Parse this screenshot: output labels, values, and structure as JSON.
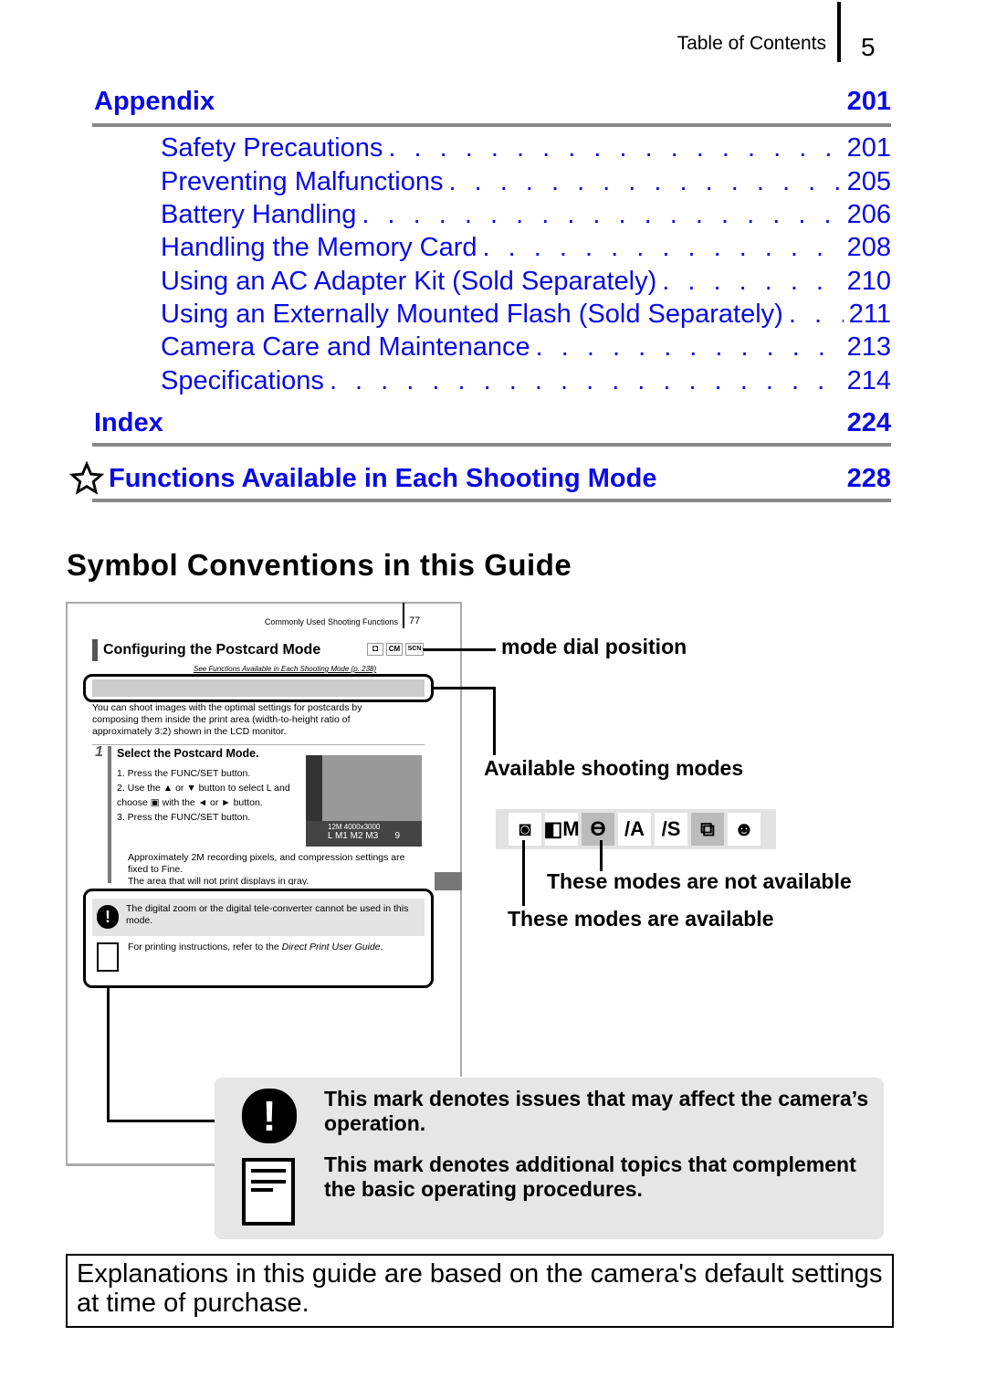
{
  "header": {
    "section": "Table of Contents",
    "page": "5"
  },
  "toc": {
    "appendix": {
      "label": "Appendix",
      "page": "201"
    },
    "entries": [
      {
        "label": "Safety Precautions",
        "page": "201"
      },
      {
        "label": "Preventing Malfunctions",
        "page": "205"
      },
      {
        "label": "Battery Handling",
        "page": "206"
      },
      {
        "label": "Handling the Memory Card",
        "page": "208"
      },
      {
        "label": "Using an AC Adapter Kit (Sold Separately)",
        "page": "210"
      },
      {
        "label": "Using an Externally Mounted Flash (Sold Separately)",
        "page": "211"
      },
      {
        "label": "Camera Care and Maintenance",
        "page": "213"
      },
      {
        "label": "Specifications",
        "page": "214"
      }
    ],
    "index": {
      "label": "Index",
      "page": "224"
    },
    "functions": {
      "label": "Functions Available in Each Shooting Mode",
      "page": "228",
      "icon": "star-icon"
    }
  },
  "symbols": {
    "title": "Symbol Conventions in this Guide",
    "sample": {
      "header": "Commonly Used Shooting Functions",
      "page": "77",
      "title": "Configuring the Postcard Mode",
      "mode_icons": [
        "camera",
        "CM",
        "SCN"
      ],
      "see_ref": "See Functions Available in Each Shooting Mode (p. 238)",
      "intro": "You can shoot images with the optimal settings for postcards by composing them inside the print area (width-to-height ratio of approximately 3:2) shown in the LCD monitor.",
      "step_num": "1",
      "step_title": "Select the Postcard Mode.",
      "steps": [
        "1. Press the FUNC/SET button.",
        "2. Use the ▲ or ▼ button to select L and choose ▣ with the ◄ or ► button.",
        "3. Press the FUNC/SET button."
      ],
      "bullets": [
        "Approximately 2M recording pixels, and compression settings are fixed to Fine.",
        "The area that will not print displays in gray."
      ],
      "lcd": {
        "res": "12M 4000x3000",
        "sizes": "L  M1 M2 M3",
        "count": "9"
      },
      "caution": "The digital zoom or the digital tele-converter cannot be used in this mode.",
      "memo_pre": "For printing instructions, refer to the ",
      "memo_em": "Direct Print User Guide",
      "memo_post": "."
    },
    "labels": {
      "mode_dial": "mode dial position",
      "available_modes": "Available shooting modes",
      "not_available": "These modes are not available",
      "available": "These modes are available"
    },
    "mode_strip": [
      "camera",
      "CM",
      "portrait-D",
      "A",
      "S",
      "stitch",
      "face"
    ],
    "notes": [
      {
        "icon": "caution-icon",
        "text": "This mark denotes issues that may affect the camera’s operation."
      },
      {
        "icon": "memo-icon",
        "text": "This mark denotes additional topics that complement the basic operating procedures."
      }
    ]
  },
  "footer": "Explanations in this guide are based on the camera's default settings at time of purchase."
}
